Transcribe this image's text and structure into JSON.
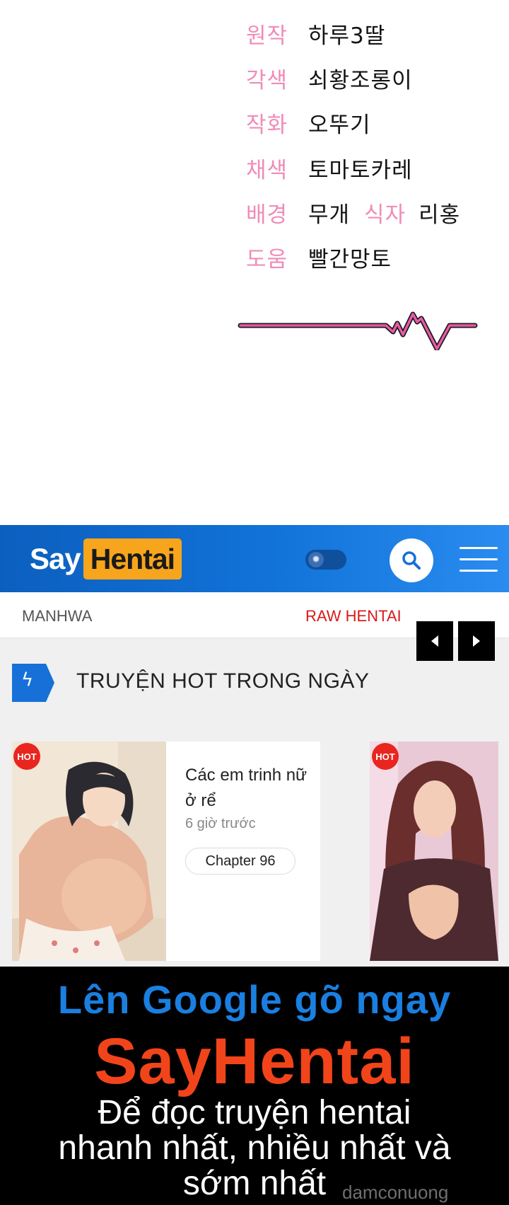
{
  "credits": {
    "rows": [
      {
        "role": "원작",
        "name": "하루3딸"
      },
      {
        "role": "각색",
        "name": "쇠황조롱이"
      },
      {
        "role": "작화",
        "name": "오뚜기"
      },
      {
        "role": "채색",
        "name": "토마토카레"
      },
      {
        "role": "배경",
        "name": "무개",
        "role2": "식자",
        "name2": "리홍"
      },
      {
        "role": "도움",
        "name": "빨간망토"
      }
    ],
    "role_color": "#f08cb8",
    "line_color": "#e85aa6"
  },
  "site": {
    "logo": {
      "say": "Say",
      "hentai": "Hentai"
    },
    "theme_toggle_icon": "sun-icon",
    "search_icon": "search-icon",
    "menu_icon": "hamburger-menu-icon",
    "nav": {
      "manhwa": "MANHWA",
      "raw_hentai": "RAW HENTAI"
    },
    "section": {
      "icon": "lightning-icon",
      "title": "TRUYỆN HOT TRONG NGÀY"
    },
    "arrows": {
      "prev": "◀",
      "next": "▶"
    },
    "cards": [
      {
        "badge": "HOT",
        "title": "Các em trinh nữ ở rể",
        "time": "6 giờ trước",
        "chapter": "Chapter 96"
      },
      {
        "badge": "HOT"
      }
    ],
    "colors": {
      "header_blue": "#1273d8",
      "logo_orange": "#f7a51c",
      "raw_red": "#d81a1a",
      "hot_red": "#e8261f"
    }
  },
  "promo": {
    "line1": "Lên Google gõ ngay",
    "line2": "SayHentai",
    "line3a": "Để đọc truyện hentai",
    "line3b": "nhanh nhất, nhiều nhất và",
    "line3c": "sớm nhất",
    "watermark": "damconuong",
    "colors": {
      "line1": "#1a7fe0",
      "line2": "#f2441a"
    }
  }
}
